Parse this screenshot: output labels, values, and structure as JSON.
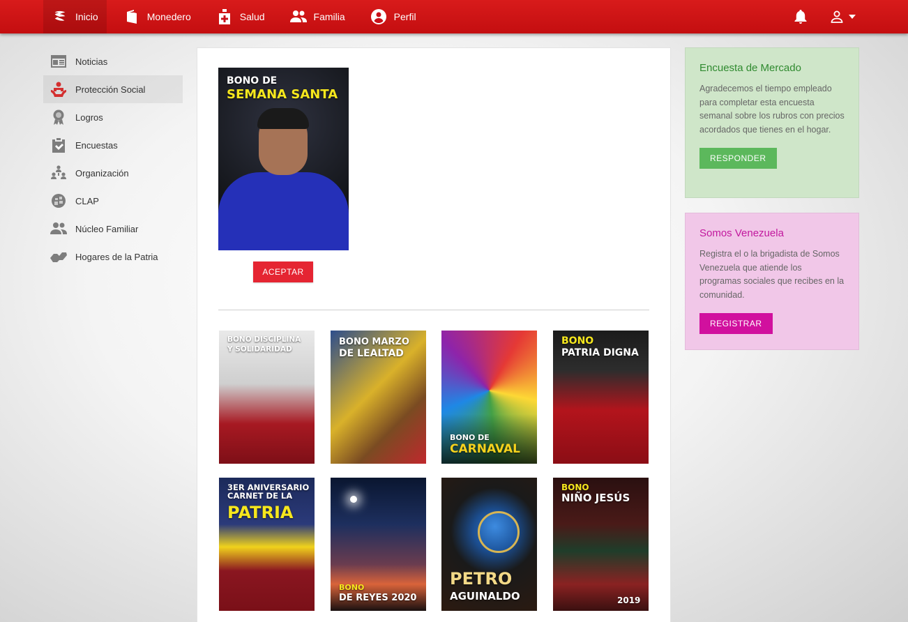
{
  "topnav": {
    "items": [
      {
        "label": "Inicio",
        "icon": "patria-logo-icon"
      },
      {
        "label": "Monedero",
        "icon": "wallet-icon"
      },
      {
        "label": "Salud",
        "icon": "health-icon"
      },
      {
        "label": "Familia",
        "icon": "family-icon"
      },
      {
        "label": "Perfil",
        "icon": "profile-icon"
      }
    ],
    "notifications_icon": "bell-icon",
    "account_icon": "user-icon"
  },
  "sidebar": {
    "items": [
      {
        "label": "Noticias",
        "icon": "news-icon"
      },
      {
        "label": "Protección Social",
        "icon": "social-protection-icon"
      },
      {
        "label": "Logros",
        "icon": "award-icon"
      },
      {
        "label": "Encuestas",
        "icon": "survey-icon"
      },
      {
        "label": "Organización",
        "icon": "organization-icon"
      },
      {
        "label": "CLAP",
        "icon": "clap-icon"
      },
      {
        "label": "Núcleo Familiar",
        "icon": "family-nucleus-icon"
      },
      {
        "label": "Hogares de la Patria",
        "icon": "hands-icon"
      }
    ]
  },
  "main": {
    "featured": {
      "line1": "BONO DE",
      "line2": "SEMANA SANTA"
    },
    "accept_button": "ACEPTAR",
    "posters": [
      {
        "line1": "BONO DISCIPLINA",
        "line2": "Y SOLIDARIDAD"
      },
      {
        "line1": "BONO MARZO",
        "line2": "DE LEALTAD"
      },
      {
        "line1": "BONO DE",
        "line2": "CARNAVAL"
      },
      {
        "line1": "BONO",
        "line2": "PATRIA DIGNA"
      },
      {
        "line1": "3ER ANIVERSARIO CARNET DE LA",
        "line2": "PATRIA"
      },
      {
        "line1": "BONO",
        "line2": "DE REYES 2020"
      },
      {
        "line1": "PETRO",
        "line2": "AGUINALDO"
      },
      {
        "line1": "BONO",
        "line2": "NIÑO JESÚS",
        "line3": "2019"
      }
    ]
  },
  "cards": {
    "market": {
      "title": "Encuesta de Mercado",
      "text": "Agradecemos el tiempo empleado para completar esta encuesta semanal sobre los rubros con precios acordados que tienes en el hogar.",
      "button": "RESPONDER"
    },
    "somos": {
      "title": "Somos Venezuela",
      "text": "Registra el o la brigadista de Somos Venezuela que atiende los programas sociales que recibes en la comunidad.",
      "button": "REGISTRAR"
    }
  },
  "colors": {
    "topbar": "#c8111a",
    "accept": "#e52532",
    "market_button": "#5cb85c",
    "somos_button": "#d1109e"
  }
}
